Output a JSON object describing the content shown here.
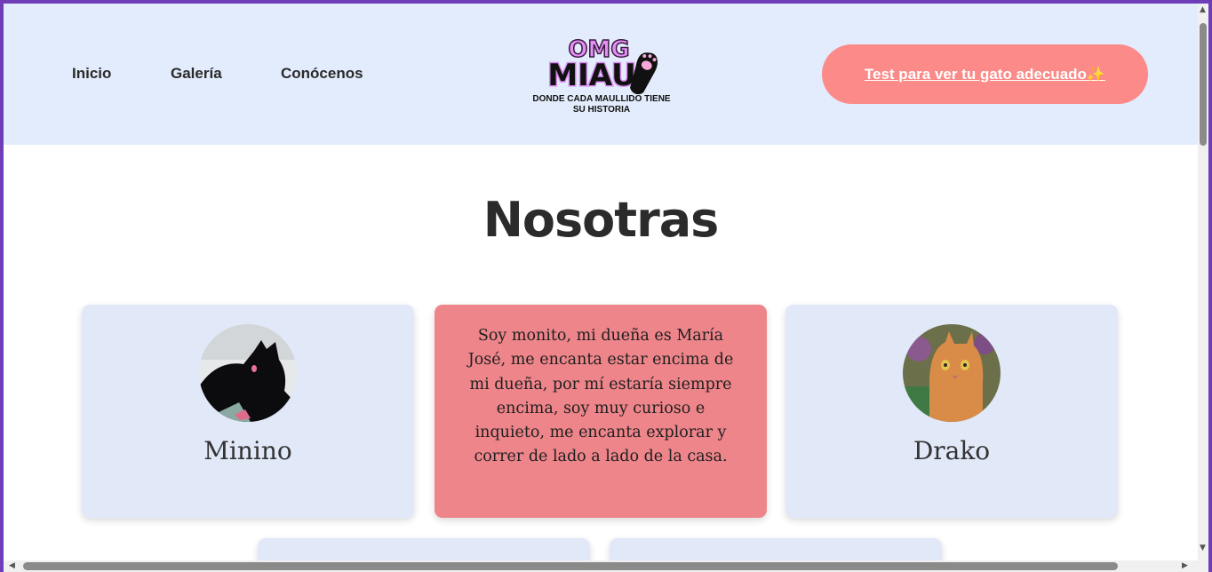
{
  "nav": {
    "items": [
      {
        "label": "Inicio"
      },
      {
        "label": "Galería"
      },
      {
        "label": "Conócenos"
      }
    ]
  },
  "logo": {
    "text_top": "OMG",
    "text_main": "MIAU",
    "tagline_line1": "DONDE CADA MAULLIDO TIENE",
    "tagline_line2": "SU HISTORIA"
  },
  "cta": {
    "label": "Test para ver tu gato adecuado✨"
  },
  "page": {
    "title": "Nosotras"
  },
  "cards": [
    {
      "name": "Minino",
      "image": "black-cat-photo"
    },
    {
      "text": "Soy monito, mi dueña es María José, me encanta estar encima de mi dueña, por mí estaría siempre encima, soy muy curioso e inquieto, me encanta explorar y correr de lado a lado de la casa."
    },
    {
      "name": "Drako",
      "image": "orange-cat-photo"
    }
  ],
  "colors": {
    "header_bg": "#e3ecfc",
    "cta_bg": "#fb8a88",
    "card_bg": "#e1e8f8",
    "card_highlight": "#ee858a",
    "window_border": "#6f3db8"
  }
}
